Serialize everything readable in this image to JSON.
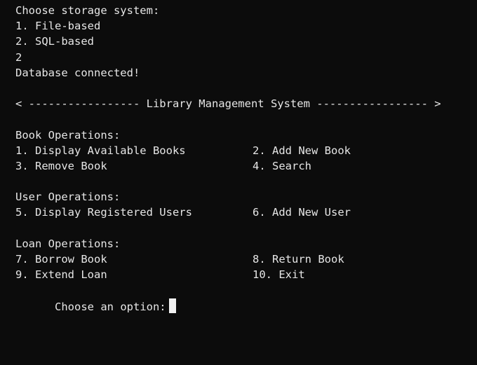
{
  "terminal": {
    "top_clipped": "  ━━━━━━━━━━ ━━━━━━━━━━━━━━━━━━━━━━━━ ━━━━━━━━━━━━",
    "storage_prompt": "Choose storage system:",
    "storage_option_1": "1. File-based",
    "storage_option_2": "2. SQL-based",
    "user_input": "2",
    "db_status": "Database connected!",
    "banner": "< ----------------- Library Management System ----------------- >",
    "book_header": "Book Operations:",
    "opt1": "1. Display Available Books",
    "opt2": "2. Add New Book",
    "opt3": "3. Remove Book",
    "opt4": "4. Search",
    "user_header": "User Operations:",
    "opt5": "5. Display Registered Users",
    "opt6": "6. Add New User",
    "loan_header": "Loan Operations:",
    "opt7": "7. Borrow Book",
    "opt8": "8. Return Book",
    "opt9": "9. Extend Loan",
    "opt10": "10. Exit",
    "option_prompt": "Choose an option:"
  },
  "colors": {
    "background": "#0c0c0c",
    "text": "#e6e6e6",
    "clipped_text": "#16c0a0",
    "cursor": "#f2f2f2"
  }
}
